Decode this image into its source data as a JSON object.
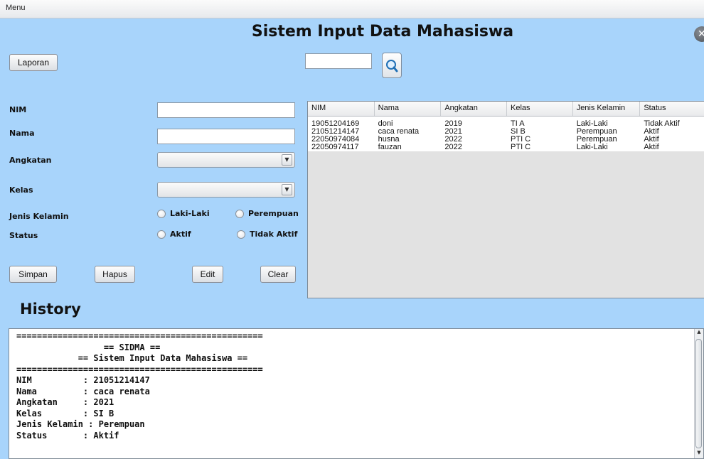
{
  "menubar": {
    "menu_label": "Menu"
  },
  "header": {
    "title": "Sistem Input Data Mahasiswa",
    "close_icon": "close-icon"
  },
  "toolbar": {
    "laporan_label": "Laporan",
    "search_value": "",
    "search_icon": "search-icon"
  },
  "form": {
    "nim_label": "NIM",
    "nim_value": "",
    "nama_label": "Nama",
    "nama_value": "",
    "angkatan_label": "Angkatan",
    "angkatan_value": "",
    "kelas_label": "Kelas",
    "kelas_value": "",
    "gender_label": "Jenis Kelamin",
    "gender_options": [
      "Laki-Laki",
      "Perempuan"
    ],
    "status_label": "Status",
    "status_options": [
      "Aktif",
      "Tidak Aktif"
    ]
  },
  "buttons": {
    "simpan": "Simpan",
    "hapus": "Hapus",
    "edit": "Edit",
    "clear": "Clear"
  },
  "table": {
    "headers": [
      "NIM",
      "Nama",
      "Angkatan",
      "Kelas",
      "Jenis Kelamin",
      "Status"
    ],
    "rows": [
      [
        "19051204169",
        "doni",
        "2019",
        "TI A",
        "Laki-Laki",
        "Tidak Aktif"
      ],
      [
        "21051214147",
        "caca renata",
        "2021",
        "SI B",
        "Perempuan",
        "Aktif"
      ],
      [
        "22050974084",
        "husna",
        "2022",
        "PTI C",
        "Perempuan",
        "Aktif"
      ],
      [
        "22050974117",
        "fauzan",
        "2022",
        "PTI C",
        "Laki-Laki",
        "Aktif"
      ]
    ]
  },
  "history": {
    "title": "History",
    "text": "================================================\n                 == SIDMA ==\n            == Sistem Input Data Mahasiswa ==\n================================================\nNIM          : 21051214147\nNama         : caca renata\nAngkatan     : 2021\nKelas        : SI B\nJenis Kelamin : Perempuan\nStatus       : Aktif"
  },
  "colors": {
    "background": "#a8d4fb",
    "table_bg": "#e2e2e2"
  }
}
